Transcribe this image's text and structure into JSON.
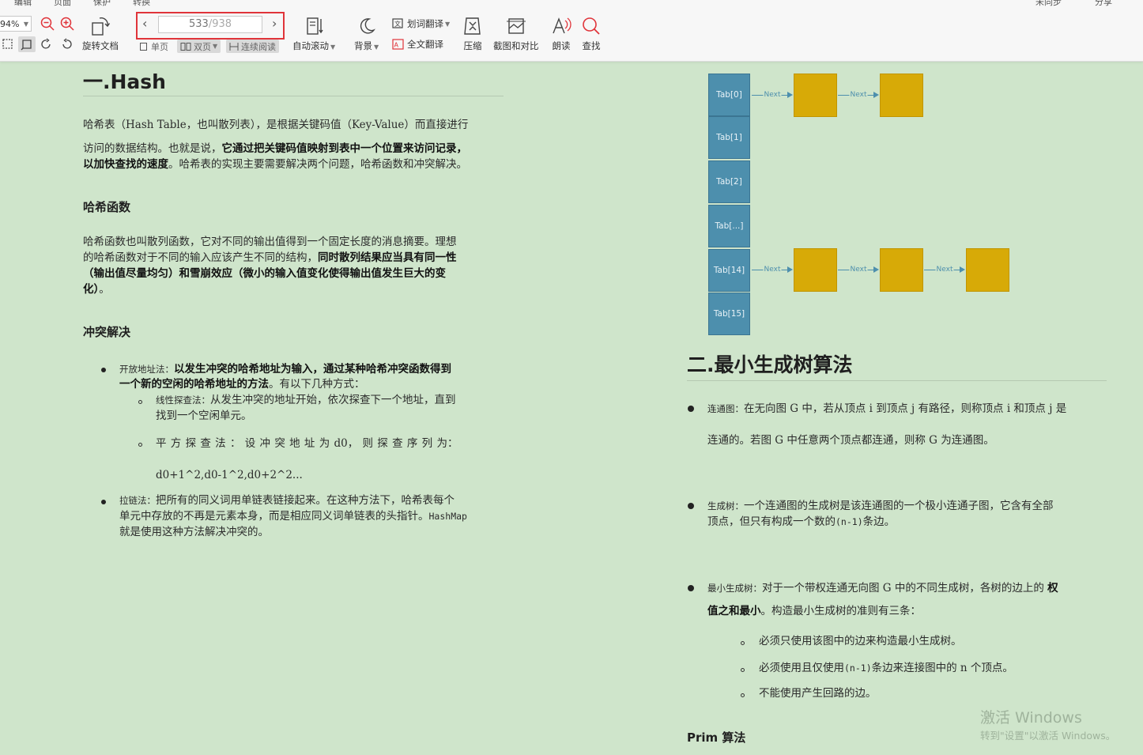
{
  "toolbar": {
    "menu_items": [
      "编辑",
      "页面",
      "保护",
      "转换"
    ],
    "top_right": [
      "未同步",
      "分享"
    ],
    "zoom_value": "94%",
    "rotate_label": "旋转文档",
    "page": {
      "current": "533",
      "total": "/938"
    },
    "modes": {
      "single": "单页",
      "double": "双页",
      "continuous": "连续阅读"
    },
    "autoscroll_label": "自动滚动",
    "background_label": "背景",
    "word_translate_label": "划词翻译",
    "full_translate_label": "全文翻译",
    "compress_label": "压缩",
    "screenshot_compare_label": "截图和对比",
    "read_aloud_label": "朗读",
    "find_label": "查找"
  },
  "left": {
    "title": "一.Hash",
    "intro1": "哈希表（Hash Table，也叫散列表），是根据关键码值（Key-Value）而直接进行",
    "intro2a": "访问的数据结构。也就是说，",
    "intro2b": "它通过把关键码值映射到表中一个位置来访问记录，",
    "intro3a": "以加快查找的速度",
    "intro3b": "。哈希表的实现主要需要解决两个问题，哈希函数和冲突解决。",
    "h_hash_func": "哈希函数",
    "hf1": "哈希函数也叫散列函数，它对不同的输出值得到一个固定长度的消息摘要。理想",
    "hf2a": "的哈希函数对于不同的输入应该产生不同的结构，",
    "hf2b": "同时散列结果应当具有同一性",
    "hf3": "（输出值尽量均匀）和雪崩效应（微小的输入值变化使得输出值发生巨大的变",
    "hf4a": "化）",
    "hf4b": "。",
    "h_conflict": "冲突解决",
    "open_label": "开放地址法：",
    "open1b": "以发生冲突的哈希地址为输入，通过某种哈希冲突函数得到",
    "open2a": "一个新的空闲的哈希地址的方法",
    "open2b": "。有以下几种方式：",
    "linear_label": "线性探查法：",
    "linear1": "从发生冲突的地址开始，依次探查下一个地址，直到",
    "linear2": "找到一个空闲单元。",
    "square_line": "平 方 探 查 法 ： 设 冲 突 地 址 为 d0， 则 探 查 序 列 为：",
    "square_seq": "d0+1^2,d0-1^2,d0+2^2...",
    "chain_label": "拉链法：",
    "chain1": "把所有的同义词用单链表链接起来。在这种方法下，哈希表每个",
    "chain2a": "单元中存放的不再是元素本身，而是相应同义词单链表的头指针。",
    "chain2b": "HashMap",
    "chain3": "就是使用这种方法解决冲突的。"
  },
  "diagram": {
    "tabs": [
      "Tab[0]",
      "Tab[1]",
      "Tab[2]",
      "Tab[...]",
      "Tab[14]",
      "Tab[15]"
    ],
    "link_label": "Next"
  },
  "right": {
    "title": "二.最小生成树算法",
    "conn_label": "连通图：",
    "conn1": "在无向图 G 中，若从顶点 i 到顶点 j 有路径，则称顶点 i 和顶点 j 是",
    "conn2": "连通的。若图 G 中任意两个顶点都连通，则称 G 为连通图。",
    "span_label": "生成树：",
    "span1": "一个连通图的生成树是该连通图的一个极小连通子图，它含有全部",
    "span2a": "顶点，但只有构成一个数的",
    "span2b": "(n-1)",
    "span2c": "条边。",
    "mst_label": "最小生成树：",
    "mst1a": "对于一个带权连通无向图 G 中的不同生成树，各树的边上的",
    "mst1b": "权",
    "mst2a": "值之和最小",
    "mst2b": "。构造最小生成树的准则有三条：",
    "rule1": "必须只使用该图中的边来构造最小生成树。",
    "rule2a": "必须使用且仅使用",
    "rule2b": "(n-1)",
    "rule2c": "条边来连接图中的 n 个顶点。",
    "rule3": "不能使用产生回路的边。",
    "prim": "Prim 算法"
  },
  "watermark": {
    "line1": "激活 Windows",
    "line2": "转到\"设置\"以激活 Windows。"
  }
}
